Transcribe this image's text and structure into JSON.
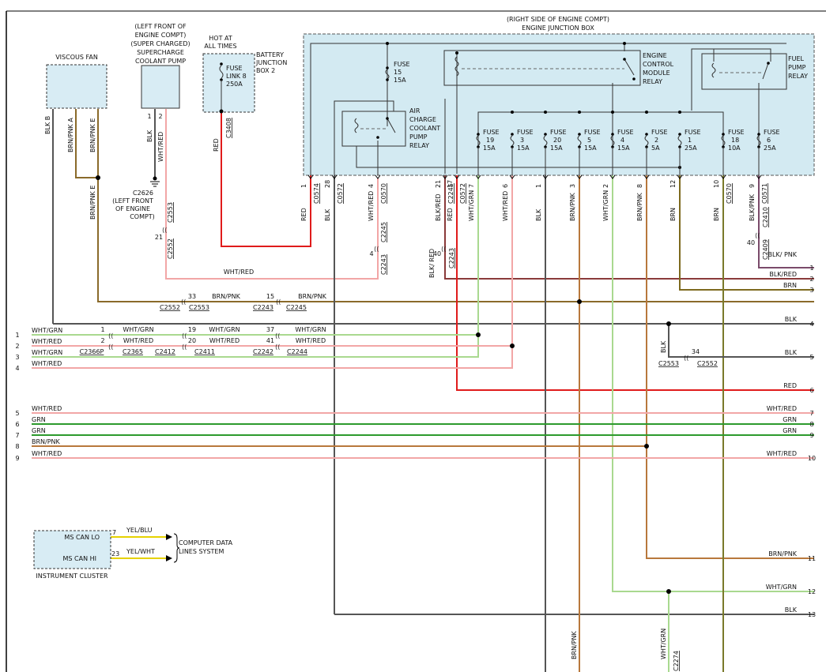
{
  "components": {
    "viscous_fan": "VISCOUS FAN",
    "coolant_pump": [
      "(LEFT FRONT OF",
      "ENGINE COMPT)",
      "(SUPER CHARGED)",
      "SUPERCHARGE",
      "COOLANT PUMP"
    ],
    "hot_at_all_times": [
      "HOT AT",
      "ALL TIMES"
    ],
    "battery_junction_box": [
      "BATTERY",
      "JUNCTION",
      "BOX 2"
    ],
    "fuse_link": [
      "FUSE",
      "LINK 8",
      "250A"
    ],
    "engine_junction_box": [
      "(RIGHT SIDE OF ENGINE COMPT)",
      "ENGINE JUNCTION BOX"
    ],
    "fuse15": [
      "FUSE",
      "15",
      "15A"
    ],
    "ecm_relay": [
      "ENGINE",
      "CONTROL",
      "MODULE",
      "RELAY"
    ],
    "fuel_pump_relay": [
      "FUEL",
      "PUMP",
      "RELAY"
    ],
    "acc_pump_relay": [
      "AIR",
      "CHARGE",
      "COOLANT",
      "PUMP",
      "RELAY"
    ],
    "ground": [
      "C2626",
      "(LEFT FRONT",
      "OF ENGINE",
      "COMPT)"
    ],
    "instrument_cluster": "INSTRUMENT CLUSTER",
    "ms_can_lo": "MS CAN LO",
    "ms_can_hi": "MS CAN HI",
    "computer_data_lines": [
      "COMPUTER DATA",
      "LINES SYSTEM"
    ]
  },
  "fuses": [
    {
      "name": "FUSE",
      "num": "19",
      "amp": "15A"
    },
    {
      "name": "FUSE",
      "num": "3",
      "amp": "15A"
    },
    {
      "name": "FUSE",
      "num": "20",
      "amp": "15A"
    },
    {
      "name": "FUSE",
      "num": "5",
      "amp": "15A"
    },
    {
      "name": "FUSE",
      "num": "4",
      "amp": "15A"
    },
    {
      "name": "FUSE",
      "num": "2",
      "amp": "5A"
    },
    {
      "name": "FUSE",
      "num": "1",
      "amp": "25A"
    },
    {
      "name": "FUSE",
      "num": "18",
      "amp": "10A"
    },
    {
      "name": "FUSE",
      "num": "6",
      "amp": "25A"
    }
  ],
  "pins": {
    "fan_b": "BLK B",
    "fan_a": "BRN/PNK A",
    "fan_e": "BRN/PNK E",
    "pump_1": "1",
    "pump_2": "2",
    "pump_blk": "BLK",
    "pump_whtred": "WHT/RED",
    "fl_red": "RED",
    "fl_conn": "C3408"
  },
  "ejb_pins": [
    {
      "num": "1",
      "wire": "RED",
      "conn": "C0574"
    },
    {
      "num": "28",
      "wire": "BLK",
      "conn": "C0572"
    },
    {
      "num": "4",
      "wire": "WHT/RED",
      "conn": "C0570"
    },
    {
      "num": "21",
      "wire": "BLK/RED",
      "conn": "C2245"
    },
    {
      "num": "17",
      "wire": "RED",
      "conn": "C0572"
    },
    {
      "num": "7",
      "wire": "WHT/GRN",
      "conn": ""
    },
    {
      "num": "6",
      "wire": "WHT/RED",
      "conn": ""
    },
    {
      "num": "1",
      "wire": "BLK",
      "conn": ""
    },
    {
      "num": "3",
      "wire": "BRN/PNK",
      "conn": ""
    },
    {
      "num": "2",
      "wire": "WHT/GRN",
      "conn": ""
    },
    {
      "num": "8",
      "wire": "BRN/PNK",
      "conn": ""
    },
    {
      "num": "12",
      "wire": "BRN",
      "conn": ""
    },
    {
      "num": "10",
      "wire": "BRN",
      "conn": "C0570"
    },
    {
      "num": "9",
      "wire": "BLK/PNK",
      "conn": "C0571"
    }
  ],
  "inline": {
    "pump_c2553": "C2553",
    "pump_21": "21",
    "pump_c2552": "C2552",
    "wr_c2245": "C2245",
    "wr_4": "4",
    "wr_c2243": "C2243",
    "br_40": "40",
    "br_blkred": "BLK/ RED",
    "br_c2243": "C2243",
    "bp_c2410": "C2410",
    "bp_40": "40",
    "bp_c2409": "C2409",
    "wr_mid": "WHT/RED",
    "bp_33": "33",
    "bp_c2552": "C2552",
    "bp_c2553": "C2553",
    "bp_brnpnk": "BRN/PNK",
    "bp_15": "15",
    "bp_brnpnk2": "BRN/PNK",
    "bp_c2243": "C2243",
    "bp_c2245": "C2245",
    "blk_vert": "BLK",
    "n34": "34",
    "c2553b": "C2553",
    "c2552b": "C2552",
    "bottom_brnpnk": "BRN/PNK",
    "bottom_whtgrn": "WHT/GRN",
    "bottom_c2274": "C2274",
    "can_7": "7",
    "can_23": "23",
    "can_yelblu": "YEL/BLU",
    "can_yelwht": "YEL/WHT"
  },
  "left_wires": [
    {
      "n": "1",
      "label": "WHT/GRN"
    },
    {
      "n": "2",
      "label": "WHT/RED"
    },
    {
      "n": "3",
      "label": "WHT/GRN"
    },
    {
      "n": "4",
      "label": "WHT/RED"
    },
    {
      "n": "5",
      "label": "WHT/RED"
    },
    {
      "n": "6",
      "label": "GRN"
    },
    {
      "n": "7",
      "label": "GRN"
    },
    {
      "n": "8",
      "label": "BRN/PNK"
    },
    {
      "n": "9",
      "label": "WHT/RED"
    }
  ],
  "chain": {
    "c1": "1",
    "c1_label": "WHT/GRN",
    "c19": "19",
    "c19_label": "WHT/GRN",
    "c37": "37",
    "c37_label": "WHT/GRN",
    "c2": "2",
    "c2_label": "WHT/RED",
    "c20": "20",
    "c20_label": "WHT/RED",
    "c41": "41",
    "c41_label": "WHT/RED",
    "c2366p": "C2366P",
    "c2365": "C2365",
    "c2412": "C2412",
    "c2411": "C2411",
    "c2242": "C2242",
    "c2244": "C2244"
  },
  "right_wires": [
    {
      "n": "1",
      "label": "BLK/ PNK"
    },
    {
      "n": "2",
      "label": "BLK/RED"
    },
    {
      "n": "3",
      "label": "BRN"
    },
    {
      "n": "4",
      "label": "BLK"
    },
    {
      "n": "5",
      "label": "BLK"
    },
    {
      "n": "6",
      "label": "RED"
    },
    {
      "n": "7",
      "label": "WHT/RED"
    },
    {
      "n": "8",
      "label": "GRN"
    },
    {
      "n": "9",
      "label": "GRN"
    },
    {
      "n": "10",
      "label": "WHT/RED"
    },
    {
      "n": "11",
      "label": "BRN/PNK"
    },
    {
      "n": "12",
      "label": "WHT/GRN"
    },
    {
      "n": "13",
      "label": "BLK"
    }
  ],
  "colors": {
    "red": "#e01b1b",
    "blk": "#555555",
    "wht_red": "#f2a6a6",
    "wht_grn": "#a9d98f",
    "grn": "#2d9a2d",
    "brn": "#7d6a1e",
    "brn_pnk": "#b8783c",
    "blk_red": "#8a3a3a",
    "yel": "#e6d200",
    "olive": "#7a7a2a"
  }
}
